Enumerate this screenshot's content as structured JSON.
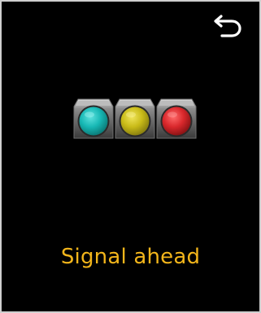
{
  "screen": {
    "message": "Signal ahead"
  },
  "icons": {
    "back": "back-arrow-icon",
    "signal_green": "traffic-light-green-icon",
    "signal_yellow": "traffic-light-yellow-icon",
    "signal_red": "traffic-light-red-icon"
  },
  "colors": {
    "background": "#000000",
    "border": "#cfcfcf",
    "label": "#f2b51b",
    "signal_green": "#17b8b5",
    "signal_yellow": "#c9bb18",
    "signal_red": "#d9282c",
    "housing": "#9a9a9a",
    "icon": "#ffffff"
  }
}
